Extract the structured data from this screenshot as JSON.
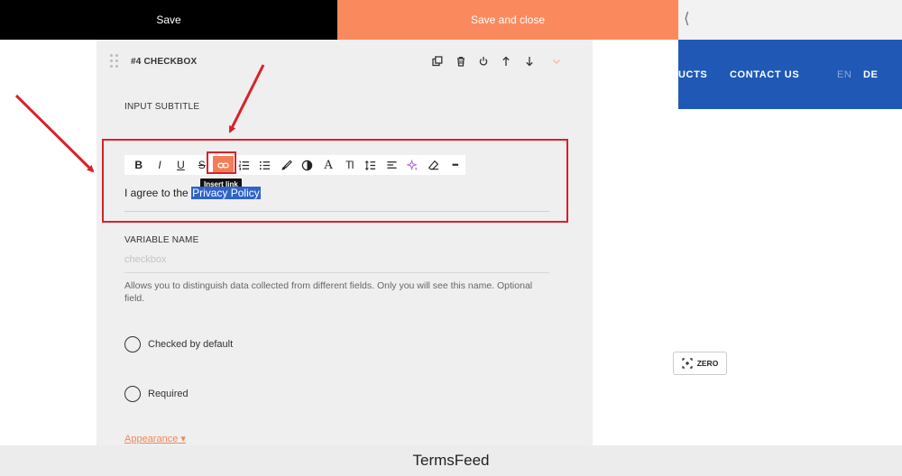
{
  "topbar": {
    "save_label": "Save",
    "save_close_label": "Save and close",
    "collapse_glyph": "⟨"
  },
  "panel": {
    "title": "#4 CHECKBOX",
    "header_icons": [
      "duplicate-icon",
      "trash-icon",
      "power-icon",
      "arrow-up-icon",
      "arrow-down-icon",
      "chevron-down-icon"
    ],
    "input_subtitle_label": "INPUT SUBTITLE",
    "toolbar_buttons": [
      "bold",
      "italic",
      "underline",
      "strikethrough",
      "insert-link",
      "ordered-list",
      "bullet-list",
      "brush",
      "color-contrast",
      "font",
      "text-size",
      "line-height",
      "align",
      "magic",
      "eraser",
      "more"
    ],
    "toolbar_glyphs": {
      "bold": "B",
      "italic": "I",
      "underline": "U",
      "strikethrough": "S",
      "font": "A",
      "text_size": "TI",
      "more": "•••"
    },
    "tooltip": "Insert link",
    "editor_text_plain": "I agree to the ",
    "editor_text_selected": "Privacy Policy",
    "variable_name_label": "VARIABLE NAME",
    "variable_name_placeholder": "checkbox",
    "help_text": "Allows you to distinguish data collected from different fields. Only you will see this name. Optional field.",
    "checked_by_default_label": "Checked by default",
    "required_label": "Required",
    "appearance_label": "Appearance",
    "appearance_caret": "▾"
  },
  "site": {
    "nav_partial": "UCTS",
    "nav_contact": "CONTACT US",
    "lang_en": "EN",
    "lang_de": "DE",
    "zero_label": "ZERO",
    "nav_color": "#1f59b5"
  },
  "footer": {
    "brand": "TermsFeed"
  },
  "colors": {
    "accent": "#fa8a5e",
    "annotation_red": "#d9212a",
    "selection_blue": "#2f63c9"
  }
}
